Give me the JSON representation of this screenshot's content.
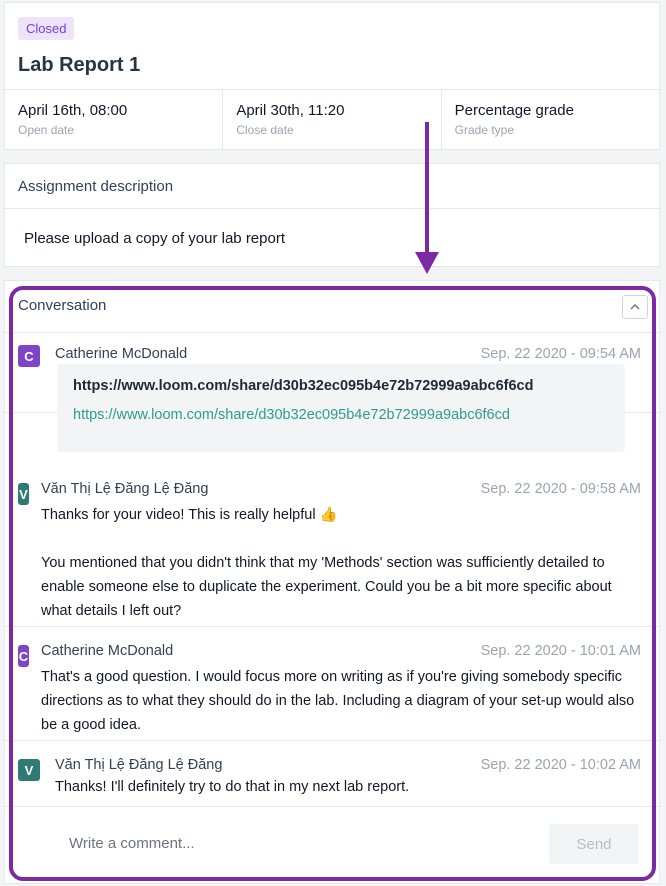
{
  "assignment": {
    "status_badge": "Closed",
    "title": "Lab Report 1",
    "meta": [
      {
        "value": "April 16th, 08:00",
        "label": "Open date"
      },
      {
        "value": "April 30th, 11:20",
        "label": "Close date"
      },
      {
        "value": "Percentage grade",
        "label": "Grade type"
      }
    ]
  },
  "description": {
    "title": "Assignment description",
    "body": "Please upload a copy of your lab report"
  },
  "conversation": {
    "title": "Conversation",
    "comments": [
      {
        "avatar_letter": "C",
        "author": "Catherine McDonald",
        "timestamp": "Sep. 22 2020 - 09:54 AM",
        "link_title": "https://www.loom.com/share/d30b32ec095b4e72b72999a9abc6f6cd",
        "link_url": "https://www.loom.com/share/d30b32ec095b4e72b72999a9abc6f6cd"
      },
      {
        "avatar_letter": "V",
        "author": "Văn Thị Lệ Đăng Lệ Đăng",
        "timestamp": "Sep. 22 2020 - 09:58 AM",
        "line1": "Thanks for your video! This is really helpful 👍",
        "line2": "You mentioned that you didn't think that my 'Methods' section was sufficiently detailed to enable someone else to duplicate the experiment. Could you be a bit more specific about what details I left out?"
      },
      {
        "avatar_letter": "C",
        "author": "Catherine McDonald",
        "timestamp": "Sep. 22 2020 - 10:01 AM",
        "body": "That's a good question. I would focus more on writing as if you're giving somebody specific directions as to what they should do in the lab. Including a diagram of your set-up would also be a good idea."
      },
      {
        "avatar_letter": "V",
        "author": "Văn Thị Lệ Đăng Lệ Đăng",
        "timestamp": "Sep. 22 2020 - 10:02 AM",
        "body": "Thanks! I'll definitely try to do that in my next lab report."
      }
    ],
    "composer": {
      "placeholder": "Write a comment...",
      "send_label": "Send"
    }
  },
  "colors": {
    "accent_purple": "#7e45c9",
    "accent_teal": "#2f7b73",
    "annotation": "#7b2aa4"
  }
}
